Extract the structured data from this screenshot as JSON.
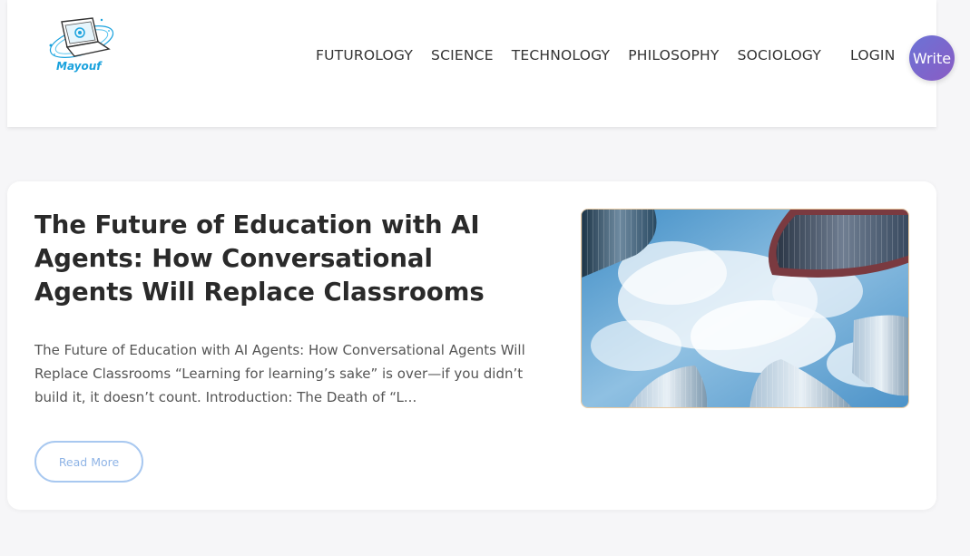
{
  "brand": {
    "logo_text": "Mayouf"
  },
  "nav": {
    "items": [
      {
        "label": "FUTUROLOGY"
      },
      {
        "label": "SCIENCE"
      },
      {
        "label": "TECHNOLOGY"
      },
      {
        "label": "PHILOSOPHY"
      },
      {
        "label": "SOCIOLOGY"
      }
    ],
    "login_label": "LOGIN",
    "write_label": "Write"
  },
  "post": {
    "title": "The Future of Education with AI Agents: How Conversational Agents Will Replace Classrooms",
    "excerpt": "The Future of Education with AI Agents: How Conversational Agents Will Replace Classrooms “Learning for learning’s sake” is over—if you didn’t build it, it doesn’t count. Introduction: The Death of “L...",
    "read_more_label": "Read More",
    "image_subject": "skyscrapers-against-sky-photo"
  },
  "colors": {
    "brand_blue": "#1aa2dd",
    "write_gradient_start": "#6b73d6",
    "write_gradient_end": "#8a5cc4",
    "read_more_border": "#a8c8f0"
  }
}
